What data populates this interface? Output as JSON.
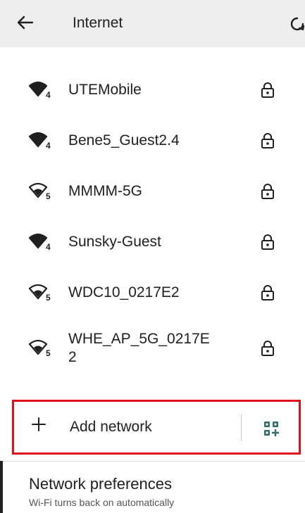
{
  "header": {
    "title": "Internet",
    "back_icon": "arrow-left-icon",
    "refresh_icon": "refresh-icon"
  },
  "networks": [
    {
      "name": "UTEMobile",
      "band": "4",
      "secured": true
    },
    {
      "name": "Bene5_Guest2.4",
      "band": "4",
      "secured": true
    },
    {
      "name": "MMMM-5G",
      "band": "5",
      "secured": true
    },
    {
      "name": "Sunsky-Guest",
      "band": "4",
      "secured": true
    },
    {
      "name": "WDC10_0217E2",
      "band": "5",
      "secured": true
    },
    {
      "name": "WHE_AP_5G_0217E\n2",
      "band": "5",
      "secured": true
    }
  ],
  "add_network": {
    "label": "Add network",
    "plus_icon": "plus-icon",
    "qr_icon": "qr-code-scan-icon",
    "highlight_color": "#e0111b"
  },
  "preferences": {
    "title": "Network preferences",
    "subtitle": "Wi-Fi turns back on automatically"
  }
}
